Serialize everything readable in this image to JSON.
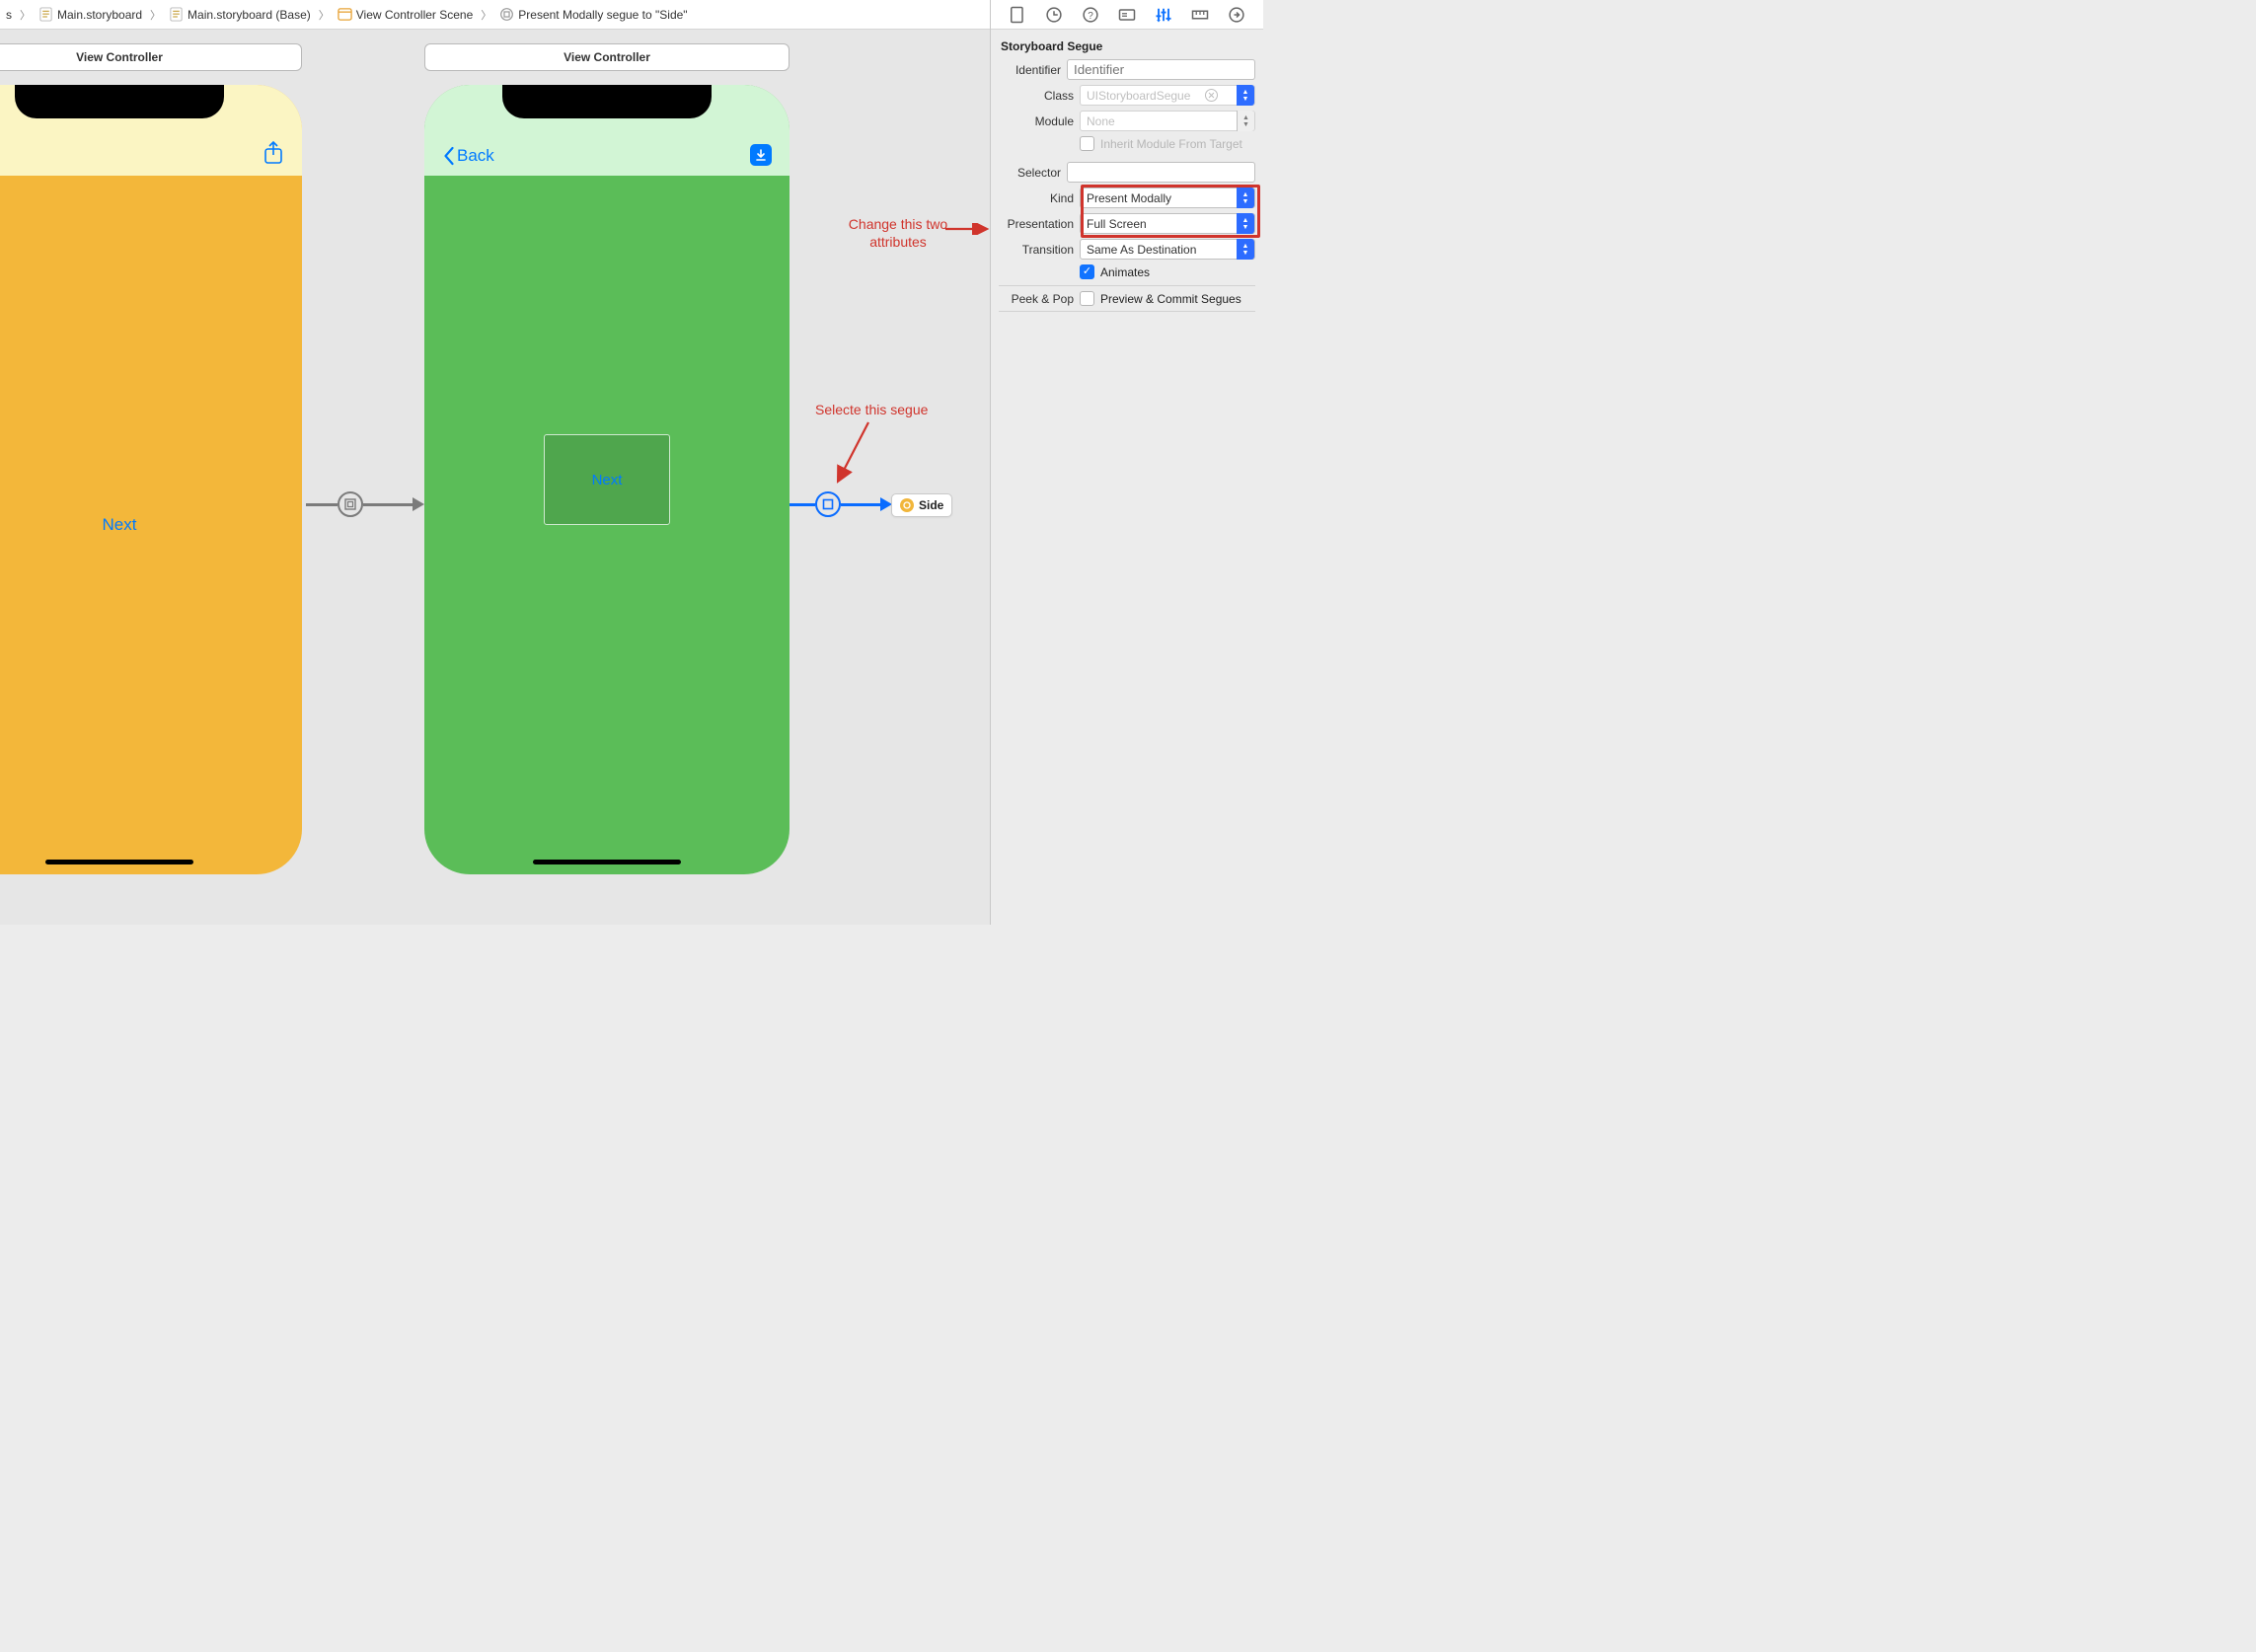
{
  "breadcrumb": {
    "item0_suffix": "s",
    "item1": "Main.storyboard",
    "item2": "Main.storyboard (Base)",
    "item3": "View Controller Scene",
    "item4": "Present Modally segue to \"Side\""
  },
  "canvas": {
    "vc1": {
      "title": "View Controller",
      "button": "Next"
    },
    "vc2": {
      "title": "View Controller",
      "back": "Back",
      "button": "Next"
    },
    "side_chip": "Side"
  },
  "annotations": {
    "select_segue": "Selecte this segue",
    "change_attrs_line1": "Change this two",
    "change_attrs_line2": "attributes"
  },
  "inspector": {
    "section": "Storyboard Segue",
    "identifier_label": "Identifier",
    "identifier_placeholder": "Identifier",
    "class_label": "Class",
    "class_value": "UIStoryboardSegue",
    "module_label": "Module",
    "module_value": "None",
    "inherit_label": "Inherit Module From Target",
    "selector_label": "Selector",
    "kind_label": "Kind",
    "kind_value": "Present Modally",
    "presentation_label": "Presentation",
    "presentation_value": "Full Screen",
    "transition_label": "Transition",
    "transition_value": "Same As Destination",
    "animates_label": "Animates",
    "peek_label": "Peek & Pop",
    "peek_value": "Preview & Commit Segues"
  }
}
